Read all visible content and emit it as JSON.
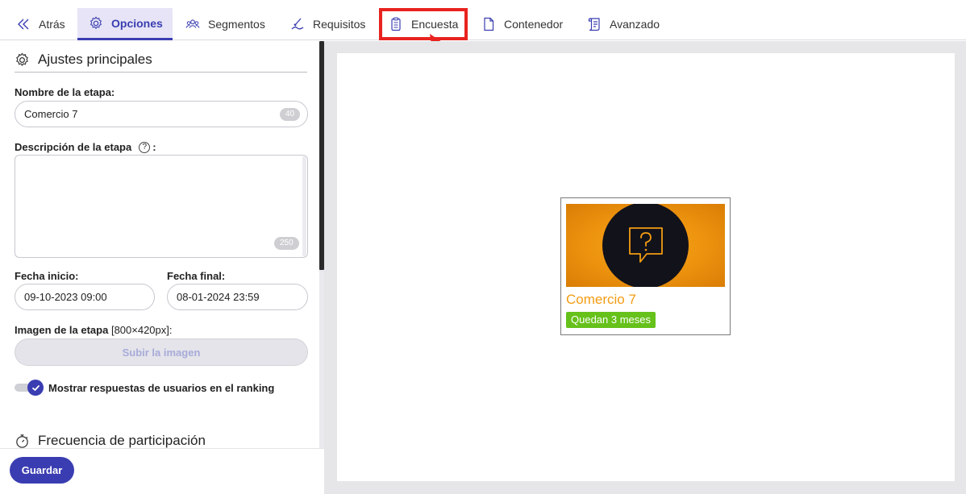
{
  "tabs": [
    {
      "label": "Atrás",
      "icon": "chevrons-left-icon"
    },
    {
      "label": "Opciones",
      "icon": "gear-icon",
      "active": true
    },
    {
      "label": "Segmentos",
      "icon": "users-group-icon"
    },
    {
      "label": "Requisitos",
      "icon": "hand-pen-icon"
    },
    {
      "label": "Encuesta",
      "icon": "clipboard-list-icon",
      "highlighted": true
    },
    {
      "label": "Contenedor",
      "icon": "document-icon"
    },
    {
      "label": "Avanzado",
      "icon": "scroll-icon"
    }
  ],
  "settings": {
    "section_title": "Ajustes principales",
    "stage_name_label": "Nombre de la etapa:",
    "stage_name_value": "Comercio 7",
    "stage_name_counter": "40",
    "description_label": "Descripción de la etapa",
    "description_help": "?",
    "description_colon": ":",
    "description_value": "",
    "description_counter": "250",
    "start_label": "Fecha inicio:",
    "start_value": "09-10-2023 09:00",
    "end_label": "Fecha final:",
    "end_value": "08-01-2024 23:59",
    "image_label": "Imagen de la etapa",
    "image_size": "[800×420px]:",
    "upload_button": "Subir la imagen",
    "show_answers_label": "Mostrar respuestas de usuarios en el ranking",
    "show_answers_enabled": true,
    "frequency_title": "Frecuencia de participación",
    "save_button": "Guardar"
  },
  "preview": {
    "card_title": "Comercio 7",
    "card_badge": "Quedan 3 meses",
    "card_icon": "question-chat-icon"
  },
  "colors": {
    "accent": "#3a3db1",
    "highlight": "#e8231f",
    "card_title": "#f39c12",
    "badge": "#66c11b"
  }
}
